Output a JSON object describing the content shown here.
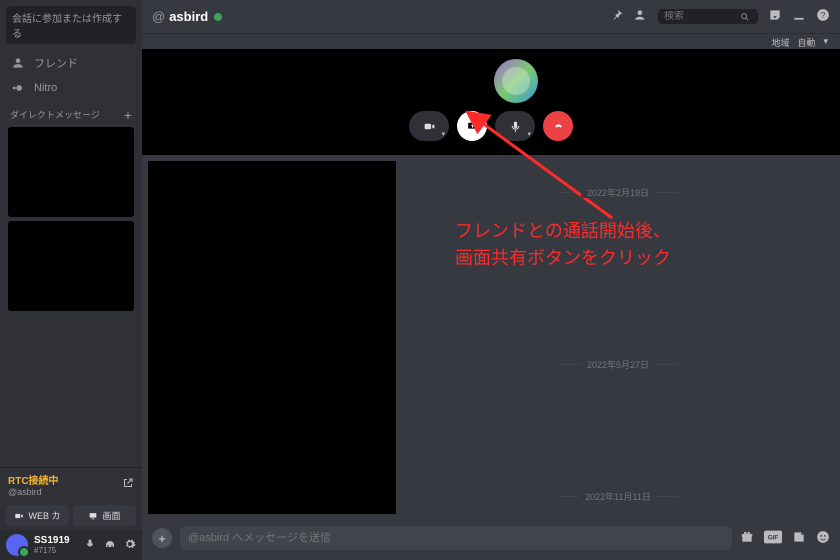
{
  "sidebar": {
    "search_placeholder": "会話に参加または作成する",
    "friends_label": "フレンド",
    "nitro_label": "Nitro",
    "dm_header": "ダイレクトメッセージ",
    "rtc_title": "RTC接続中",
    "rtc_sub": "@asbird",
    "btn_web": "WEB カ",
    "btn_screen": "画面",
    "user_name": "SS1919",
    "user_tag": "#7175"
  },
  "topbar": {
    "at": "@",
    "channel": "asbird",
    "search_placeholder": "検索",
    "sub_region": "地域",
    "sub_auto": "自動"
  },
  "dividers": [
    "2022年2月19日",
    "2022年5月27日",
    "2022年11月11日"
  ],
  "composer": {
    "placeholder": "@asbird へメッセージを送信"
  },
  "annotation": {
    "line1": "フレンドとの通話開始後、",
    "line2": "画面共有ボタンをクリック"
  }
}
